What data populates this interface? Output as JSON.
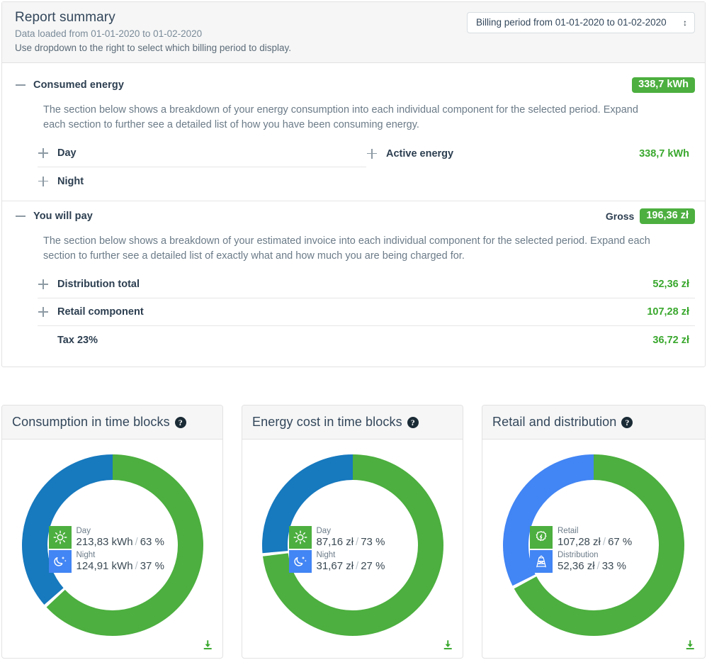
{
  "header": {
    "title": "Report summary",
    "subtitle_1": "Data loaded from 01-01-2020 to 01-02-2020",
    "subtitle_2": "Use dropdown to the right to select which billing period to display.",
    "period_select": {
      "name": "billing-period-select",
      "selected": "Billing period from 01-01-2020 to 01-02-2020"
    }
  },
  "sections": [
    {
      "title": "Consumed energy",
      "badge": "338,7 kWh",
      "description": "The section below shows a breakdown of your energy consumption into each individual component for the selected period. Expand each section to further see a detailed list of how you have been consuming energy.",
      "rows_left": [
        {
          "label": "Day",
          "value": ""
        },
        {
          "label": "Night",
          "value": ""
        }
      ],
      "rows_right": [
        {
          "label": "Active energy",
          "value": "338,7 kWh"
        }
      ]
    },
    {
      "title": "You will pay",
      "gross_label": "Gross",
      "badge": "196,36 zł",
      "description": "The section below shows a breakdown of your estimated invoice into each individual component for the selected period. Expand each section to further see a detailed list of exactly what and how much you are being charged for.",
      "rows": [
        {
          "label": "Distribution total",
          "value": "52,36 zł"
        },
        {
          "label": "Retail component",
          "value": "107,28 zł"
        },
        {
          "label": "Tax 23%",
          "value": "36,72 zł"
        }
      ]
    }
  ],
  "colors": {
    "green": "#4caf3f",
    "green_text": "#3aa82e",
    "blue_dark": "#1779be",
    "blue_bright": "#4285f4",
    "arc_green": "#4caf3f"
  },
  "cards": [
    {
      "title": "Consumption in time blocks",
      "help_icon": "question-mark-icon",
      "download_icon": "download-icon",
      "legend": [
        {
          "icon": "sun-icon",
          "name": "Day",
          "value": "213,83 kWh",
          "percent": "63 %"
        },
        {
          "icon": "moon-icon",
          "name": "Night",
          "value": "124,91 kWh",
          "percent": "37 %"
        }
      ],
      "chart_data": {
        "type": "pie",
        "title": "Consumption in time blocks",
        "labels": [
          "Day",
          "Night"
        ],
        "values": [
          213.83,
          124.91
        ],
        "unit": "kWh",
        "percents": [
          63,
          37
        ],
        "colors": [
          "#4caf3f",
          "#1779be"
        ],
        "legend": "center",
        "donut": true
      }
    },
    {
      "title": "Energy cost in time blocks",
      "help_icon": "question-mark-icon",
      "download_icon": "download-icon",
      "legend": [
        {
          "icon": "sun-icon",
          "name": "Day",
          "value": "87,16 zł",
          "percent": "73 %"
        },
        {
          "icon": "moon-icon",
          "name": "Night",
          "value": "31,67 zł",
          "percent": "27 %"
        }
      ],
      "chart_data": {
        "type": "pie",
        "title": "Energy cost in time blocks",
        "labels": [
          "Day",
          "Night"
        ],
        "values": [
          87.16,
          31.67
        ],
        "unit": "zł",
        "percents": [
          73,
          27
        ],
        "colors": [
          "#4caf3f",
          "#1779be"
        ],
        "legend": "center",
        "donut": true
      }
    },
    {
      "title": "Retail and distribution",
      "help_icon": "question-mark-icon",
      "download_icon": "download-icon",
      "legend": [
        {
          "icon": "gear-icon",
          "name": "Retail",
          "value": "107,28 zł",
          "percent": "67 %"
        },
        {
          "icon": "pylon-icon",
          "name": "Distribution",
          "value": "52,36 zł",
          "percent": "33 %"
        }
      ],
      "chart_data": {
        "type": "pie",
        "title": "Retail and distribution",
        "labels": [
          "Retail",
          "Distribution"
        ],
        "values": [
          107.28,
          52.36
        ],
        "unit": "zł",
        "percents": [
          67,
          33
        ],
        "colors": [
          "#4caf3f",
          "#4285f4"
        ],
        "legend": "center",
        "donut": true
      }
    }
  ]
}
